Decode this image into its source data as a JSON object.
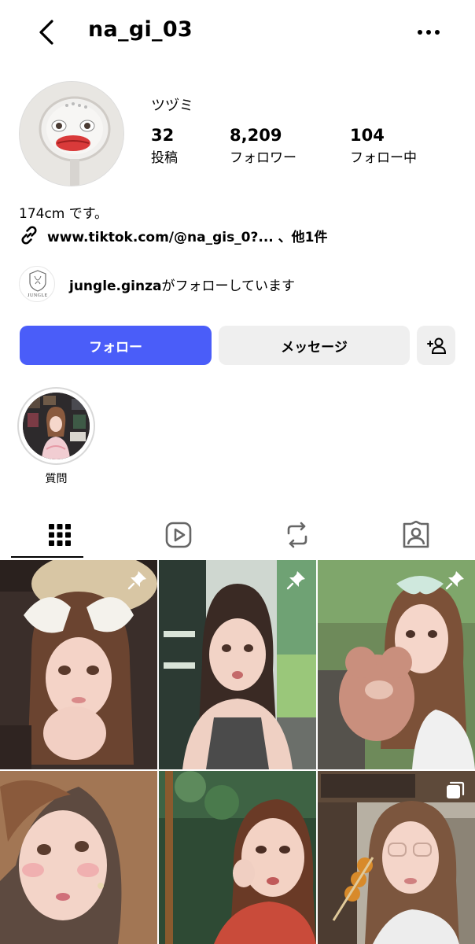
{
  "header": {
    "username": "na_gi_03"
  },
  "profile": {
    "display_name": "ツヅミ",
    "stats": {
      "posts": {
        "value": "32",
        "label": "投稿"
      },
      "followers": {
        "value": "8,209",
        "label": "フォロワー"
      },
      "following": {
        "value": "104",
        "label": "フォロー中"
      }
    },
    "bio": "174cm です。",
    "link": "www.tiktok.com/@na_gis_0?... 、他1件",
    "mutual": {
      "account": "jungle.ginza",
      "suffix": "がフォローしています",
      "logo_text": "JUNGLE"
    }
  },
  "actions": {
    "follow_label": "フォロー",
    "message_label": "メッセージ"
  },
  "highlights": [
    {
      "label": "質問"
    }
  ],
  "tabs": [
    {
      "icon": "grid-icon",
      "active": true
    },
    {
      "icon": "reels-icon",
      "active": false
    },
    {
      "icon": "reposts-icon",
      "active": false
    },
    {
      "icon": "tagged-icon",
      "active": false
    }
  ],
  "posts": [
    {
      "pinned": true,
      "kind": "photo"
    },
    {
      "pinned": true,
      "kind": "photo"
    },
    {
      "pinned": true,
      "kind": "photo"
    },
    {
      "pinned": false,
      "kind": "photo"
    },
    {
      "pinned": false,
      "kind": "photo"
    },
    {
      "pinned": false,
      "kind": "carousel"
    }
  ],
  "colors": {
    "follow_button": "#4a5df9",
    "secondary_button": "#efefef"
  }
}
